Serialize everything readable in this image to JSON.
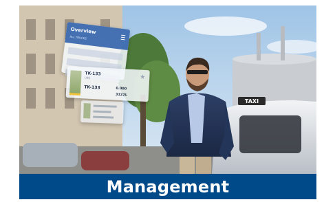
{
  "banner": {
    "title": "Management"
  },
  "overview_card": {
    "title": "Overview",
    "subtitle": "ALL TRUCKS"
  },
  "tank_card": {
    "name": "TK-133",
    "type": "LNG",
    "value_primary": "TK-133",
    "value_secondary": "0.000",
    "value_tertiary": "3122L"
  },
  "taxi_sign": "TAXI",
  "colors": {
    "banner_bg": "#004a8a",
    "banner_text": "#ffffff",
    "overview_header": "#2c5eaa"
  }
}
